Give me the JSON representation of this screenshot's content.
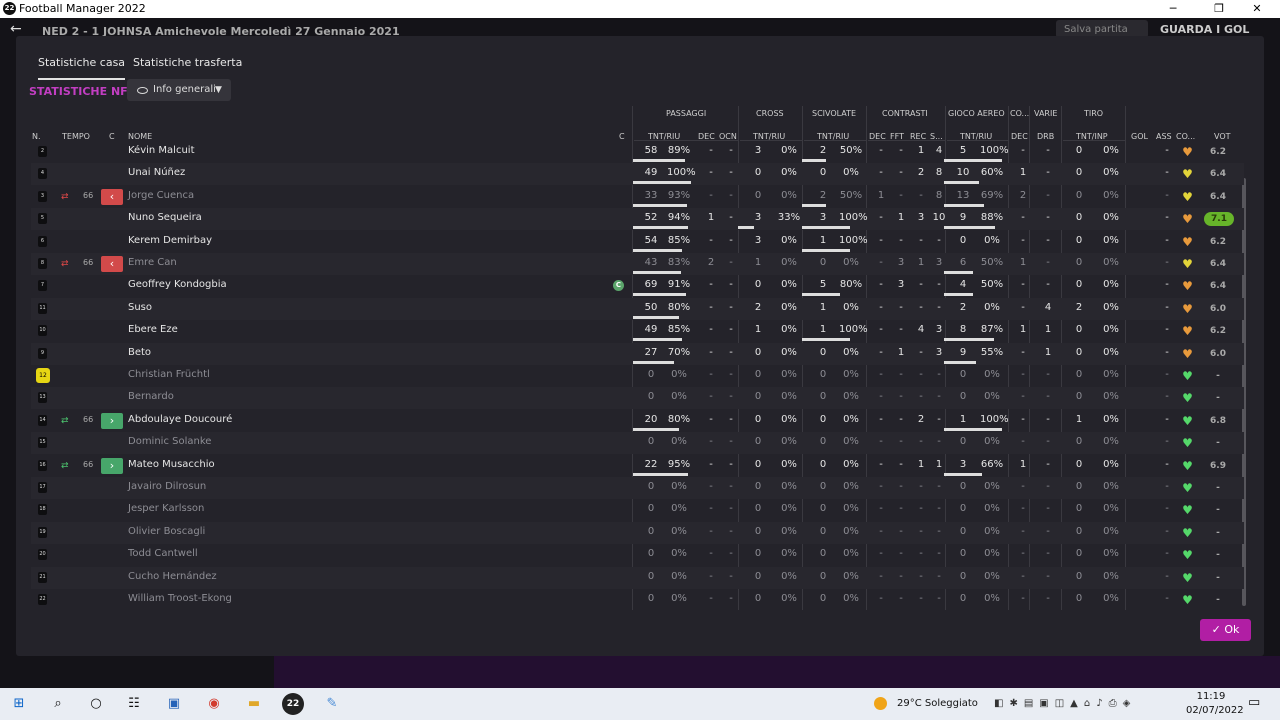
{
  "window": {
    "title": "Football Manager 2022",
    "logo": "22",
    "minimize": "─",
    "maximize": "❐",
    "close": "✕"
  },
  "topbar": {
    "match": "NED  2 - 1  JOHNSA  Amichevole  Mercoledì 27 Gennaio 2021",
    "save_label": "Salva partita",
    "watch_label": "GUARDA I GOL"
  },
  "tabs": [
    "Statistiche casa",
    "Statistiche trasferta"
  ],
  "team_label": "STATISTICHE NFD",
  "view_dropdown": "Info generali",
  "col_groups": {
    "passaggi": "PASSAGGI",
    "cross": "CROSS",
    "scivolate": "SCIVOLATE",
    "contrasti": "CONTRASTI",
    "gioco_aereo": "GIOCO AEREO",
    "co": "CO...",
    "varie": "VARIE",
    "tiro": "TIRO"
  },
  "cols": {
    "n": "N.",
    "tempo": "TEMPO",
    "c": "C",
    "nome": "NOME",
    "c2": "C",
    "tnt_riu": "TNT/RIU",
    "dec": "DEC",
    "ocn": "OCN",
    "fft": "FFT",
    "rec": "REC",
    "s": "S...",
    "drb": "DRB",
    "tnt_inp": "TNT/INP",
    "gol": "GOL",
    "ass": "ASS",
    "co": "CO...",
    "vot": "VOT"
  },
  "players": [
    {
      "num": "2",
      "name": "Kévin Malcuit",
      "active": true,
      "pass": [
        "58",
        "89%"
      ],
      "pdec": "-",
      "pocn": "-",
      "cross": [
        "3",
        "0%"
      ],
      "sciv": [
        "2",
        "50%"
      ],
      "cdec": "-",
      "cfft": "-",
      "crec": "1",
      "cs": "4",
      "aer": [
        "5",
        "100%"
      ],
      "adec": "-",
      "drb": "-",
      "tiro": [
        "0",
        "0%"
      ],
      "gol": "",
      "ass": "-",
      "heart": "orange",
      "rating": "6.2",
      "bars": [
        0.89,
        0,
        0.5,
        1
      ]
    },
    {
      "num": "4",
      "name": "Unai Núñez",
      "active": true,
      "pass": [
        "49",
        "100%"
      ],
      "pdec": "-",
      "pocn": "-",
      "cross": [
        "0",
        "0%"
      ],
      "sciv": [
        "0",
        "0%"
      ],
      "cdec": "-",
      "cfft": "-",
      "crec": "2",
      "cs": "8",
      "aer": [
        "10",
        "60%"
      ],
      "adec": "1",
      "drb": "-",
      "tiro": [
        "0",
        "0%"
      ],
      "gol": "",
      "ass": "-",
      "heart": "yellow",
      "rating": "6.4",
      "bars": [
        1,
        0,
        0,
        0.6
      ]
    },
    {
      "num": "3",
      "name": "Jorge Cuenca",
      "active": false,
      "sub": "out",
      "min": "66",
      "pass": [
        "33",
        "93%"
      ],
      "pdec": "-",
      "pocn": "-",
      "cross": [
        "0",
        "0%"
      ],
      "sciv": [
        "2",
        "50%"
      ],
      "cdec": "1",
      "cfft": "-",
      "crec": "-",
      "cs": "8",
      "aer": [
        "13",
        "69%"
      ],
      "adec": "2",
      "drb": "-",
      "tiro": [
        "0",
        "0%"
      ],
      "gol": "",
      "ass": "-",
      "heart": "yellow",
      "rating": "6.4",
      "bars": [
        0.93,
        0,
        0.5,
        0.69
      ]
    },
    {
      "num": "5",
      "name": "Nuno Sequeira",
      "active": true,
      "pass": [
        "52",
        "94%"
      ],
      "pdec": "1",
      "pocn": "-",
      "cross": [
        "3",
        "33%"
      ],
      "sciv": [
        "3",
        "100%"
      ],
      "cdec": "-",
      "cfft": "1",
      "crec": "3",
      "cs": "10",
      "aer": [
        "9",
        "88%"
      ],
      "adec": "-",
      "drb": "-",
      "tiro": [
        "0",
        "0%"
      ],
      "gol": "",
      "ass": "-",
      "heart": "orange",
      "rating": "7.1",
      "best": true,
      "bars": [
        0.94,
        0.33,
        1,
        0.88
      ]
    },
    {
      "num": "6",
      "name": "Kerem Demirbay",
      "active": true,
      "pass": [
        "54",
        "85%"
      ],
      "pdec": "-",
      "pocn": "-",
      "cross": [
        "3",
        "0%"
      ],
      "sciv": [
        "1",
        "100%"
      ],
      "cdec": "-",
      "cfft": "-",
      "crec": "-",
      "cs": "-",
      "aer": [
        "0",
        "0%"
      ],
      "adec": "-",
      "drb": "-",
      "tiro": [
        "0",
        "0%"
      ],
      "gol": "",
      "ass": "-",
      "heart": "orange",
      "rating": "6.2",
      "bars": [
        0.85,
        0,
        1,
        0
      ]
    },
    {
      "num": "8",
      "name": "Emre Can",
      "active": false,
      "sub": "out",
      "min": "66",
      "pass": [
        "43",
        "83%"
      ],
      "pdec": "2",
      "pocn": "-",
      "cross": [
        "1",
        "0%"
      ],
      "sciv": [
        "0",
        "0%"
      ],
      "cdec": "-",
      "cfft": "3",
      "crec": "1",
      "cs": "3",
      "aer": [
        "6",
        "50%"
      ],
      "adec": "1",
      "drb": "-",
      "tiro": [
        "0",
        "0%"
      ],
      "gol": "",
      "ass": "-",
      "heart": "yellow",
      "rating": "6.4",
      "bars": [
        0.83,
        0,
        0,
        0.5
      ]
    },
    {
      "num": "7",
      "name": "Geoffrey Kondogbia",
      "active": true,
      "captain": "C",
      "pass": [
        "69",
        "91%"
      ],
      "pdec": "-",
      "pocn": "-",
      "cross": [
        "0",
        "0%"
      ],
      "sciv": [
        "5",
        "80%"
      ],
      "cdec": "-",
      "cfft": "3",
      "crec": "-",
      "cs": "-",
      "aer": [
        "4",
        "50%"
      ],
      "adec": "-",
      "drb": "-",
      "tiro": [
        "0",
        "0%"
      ],
      "gol": "",
      "ass": "-",
      "heart": "orange",
      "rating": "6.4",
      "bars": [
        0.91,
        0,
        0.8,
        0.5
      ]
    },
    {
      "num": "11",
      "name": "Suso",
      "active": true,
      "pass": [
        "50",
        "80%"
      ],
      "pdec": "-",
      "pocn": "-",
      "cross": [
        "2",
        "0%"
      ],
      "sciv": [
        "1",
        "0%"
      ],
      "cdec": "-",
      "cfft": "-",
      "crec": "-",
      "cs": "-",
      "aer": [
        "2",
        "0%"
      ],
      "adec": "-",
      "drb": "4",
      "tiro": [
        "2",
        "0%"
      ],
      "gol": "",
      "ass": "-",
      "heart": "orange",
      "rating": "6.0",
      "bars": [
        0.8,
        0,
        0,
        0
      ]
    },
    {
      "num": "10",
      "name": "Ebere Eze",
      "active": true,
      "pass": [
        "49",
        "85%"
      ],
      "pdec": "-",
      "pocn": "-",
      "cross": [
        "1",
        "0%"
      ],
      "sciv": [
        "1",
        "100%"
      ],
      "cdec": "-",
      "cfft": "-",
      "crec": "4",
      "cs": "3",
      "aer": [
        "8",
        "87%"
      ],
      "adec": "1",
      "drb": "1",
      "tiro": [
        "0",
        "0%"
      ],
      "gol": "",
      "ass": "-",
      "heart": "orange",
      "rating": "6.2",
      "bars": [
        0.85,
        0,
        1,
        0.87
      ]
    },
    {
      "num": "9",
      "name": "Beto",
      "active": true,
      "pass": [
        "27",
        "70%"
      ],
      "pdec": "-",
      "pocn": "-",
      "cross": [
        "0",
        "0%"
      ],
      "sciv": [
        "0",
        "0%"
      ],
      "cdec": "-",
      "cfft": "1",
      "crec": "-",
      "cs": "3",
      "aer": [
        "9",
        "55%"
      ],
      "adec": "-",
      "drb": "1",
      "tiro": [
        "0",
        "0%"
      ],
      "gol": "",
      "ass": "-",
      "heart": "orange",
      "rating": "6.0",
      "bars": [
        0.7,
        0,
        0,
        0.55
      ]
    },
    {
      "num": "12",
      "name": "Christian Früchtl",
      "active": false,
      "gk": true,
      "pass": [
        "0",
        "0%"
      ],
      "pdec": "-",
      "pocn": "-",
      "cross": [
        "0",
        "0%"
      ],
      "sciv": [
        "0",
        "0%"
      ],
      "cdec": "-",
      "cfft": "-",
      "crec": "-",
      "cs": "-",
      "aer": [
        "0",
        "0%"
      ],
      "adec": "-",
      "drb": "-",
      "tiro": [
        "0",
        "0%"
      ],
      "gol": "",
      "ass": "-",
      "heart": "green",
      "rating": "-",
      "bars": [
        0,
        0,
        0,
        0
      ]
    },
    {
      "num": "13",
      "name": "Bernardo",
      "active": false,
      "pass": [
        "0",
        "0%"
      ],
      "pdec": "-",
      "pocn": "-",
      "cross": [
        "0",
        "0%"
      ],
      "sciv": [
        "0",
        "0%"
      ],
      "cdec": "-",
      "cfft": "-",
      "crec": "-",
      "cs": "-",
      "aer": [
        "0",
        "0%"
      ],
      "adec": "-",
      "drb": "-",
      "tiro": [
        "0",
        "0%"
      ],
      "gol": "",
      "ass": "-",
      "heart": "green",
      "rating": "-",
      "bars": [
        0,
        0,
        0,
        0
      ]
    },
    {
      "num": "14",
      "name": "Abdoulaye Doucouré",
      "active": true,
      "sub": "in",
      "min": "66",
      "pass": [
        "20",
        "80%"
      ],
      "pdec": "-",
      "pocn": "-",
      "cross": [
        "0",
        "0%"
      ],
      "sciv": [
        "0",
        "0%"
      ],
      "cdec": "-",
      "cfft": "-",
      "crec": "2",
      "cs": "-",
      "aer": [
        "1",
        "100%"
      ],
      "adec": "-",
      "drb": "-",
      "tiro": [
        "1",
        "0%"
      ],
      "gol": "",
      "ass": "-",
      "heart": "green",
      "rating": "6.8",
      "bars": [
        0.8,
        0,
        0,
        1
      ]
    },
    {
      "num": "15",
      "name": "Dominic Solanke",
      "active": false,
      "pass": [
        "0",
        "0%"
      ],
      "pdec": "-",
      "pocn": "-",
      "cross": [
        "0",
        "0%"
      ],
      "sciv": [
        "0",
        "0%"
      ],
      "cdec": "-",
      "cfft": "-",
      "crec": "-",
      "cs": "-",
      "aer": [
        "0",
        "0%"
      ],
      "adec": "-",
      "drb": "-",
      "tiro": [
        "0",
        "0%"
      ],
      "gol": "",
      "ass": "-",
      "heart": "green",
      "rating": "-",
      "bars": [
        0,
        0,
        0,
        0
      ]
    },
    {
      "num": "16",
      "name": "Mateo Musacchio",
      "active": true,
      "sub": "in",
      "min": "66",
      "pass": [
        "22",
        "95%"
      ],
      "pdec": "-",
      "pocn": "-",
      "cross": [
        "0",
        "0%"
      ],
      "sciv": [
        "0",
        "0%"
      ],
      "cdec": "-",
      "cfft": "-",
      "crec": "1",
      "cs": "1",
      "aer": [
        "3",
        "66%"
      ],
      "adec": "1",
      "drb": "-",
      "tiro": [
        "0",
        "0%"
      ],
      "gol": "",
      "ass": "-",
      "heart": "green",
      "rating": "6.9",
      "bars": [
        0.95,
        0,
        0,
        0.66
      ]
    },
    {
      "num": "17",
      "name": "Javairo Dilrosun",
      "active": false,
      "pass": [
        "0",
        "0%"
      ],
      "pdec": "-",
      "pocn": "-",
      "cross": [
        "0",
        "0%"
      ],
      "sciv": [
        "0",
        "0%"
      ],
      "cdec": "-",
      "cfft": "-",
      "crec": "-",
      "cs": "-",
      "aer": [
        "0",
        "0%"
      ],
      "adec": "-",
      "drb": "-",
      "tiro": [
        "0",
        "0%"
      ],
      "gol": "",
      "ass": "-",
      "heart": "green",
      "rating": "-",
      "bars": [
        0,
        0,
        0,
        0
      ]
    },
    {
      "num": "18",
      "name": "Jesper Karlsson",
      "active": false,
      "pass": [
        "0",
        "0%"
      ],
      "pdec": "-",
      "pocn": "-",
      "cross": [
        "0",
        "0%"
      ],
      "sciv": [
        "0",
        "0%"
      ],
      "cdec": "-",
      "cfft": "-",
      "crec": "-",
      "cs": "-",
      "aer": [
        "0",
        "0%"
      ],
      "adec": "-",
      "drb": "-",
      "tiro": [
        "0",
        "0%"
      ],
      "gol": "",
      "ass": "-",
      "heart": "green",
      "rating": "-",
      "bars": [
        0,
        0,
        0,
        0
      ]
    },
    {
      "num": "19",
      "name": "Olivier Boscagli",
      "active": false,
      "pass": [
        "0",
        "0%"
      ],
      "pdec": "-",
      "pocn": "-",
      "cross": [
        "0",
        "0%"
      ],
      "sciv": [
        "0",
        "0%"
      ],
      "cdec": "-",
      "cfft": "-",
      "crec": "-",
      "cs": "-",
      "aer": [
        "0",
        "0%"
      ],
      "adec": "-",
      "drb": "-",
      "tiro": [
        "0",
        "0%"
      ],
      "gol": "",
      "ass": "-",
      "heart": "green",
      "rating": "-",
      "bars": [
        0,
        0,
        0,
        0
      ]
    },
    {
      "num": "20",
      "name": "Todd Cantwell",
      "active": false,
      "pass": [
        "0",
        "0%"
      ],
      "pdec": "-",
      "pocn": "-",
      "cross": [
        "0",
        "0%"
      ],
      "sciv": [
        "0",
        "0%"
      ],
      "cdec": "-",
      "cfft": "-",
      "crec": "-",
      "cs": "-",
      "aer": [
        "0",
        "0%"
      ],
      "adec": "-",
      "drb": "-",
      "tiro": [
        "0",
        "0%"
      ],
      "gol": "",
      "ass": "-",
      "heart": "green",
      "rating": "-",
      "bars": [
        0,
        0,
        0,
        0
      ]
    },
    {
      "num": "21",
      "name": "Cucho Hernández",
      "active": false,
      "pass": [
        "0",
        "0%"
      ],
      "pdec": "-",
      "pocn": "-",
      "cross": [
        "0",
        "0%"
      ],
      "sciv": [
        "0",
        "0%"
      ],
      "cdec": "-",
      "cfft": "-",
      "crec": "-",
      "cs": "-",
      "aer": [
        "0",
        "0%"
      ],
      "adec": "-",
      "drb": "-",
      "tiro": [
        "0",
        "0%"
      ],
      "gol": "",
      "ass": "-",
      "heart": "green",
      "rating": "-",
      "bars": [
        0,
        0,
        0,
        0
      ]
    },
    {
      "num": "22",
      "name": "William Troost-Ekong",
      "active": false,
      "pass": [
        "0",
        "0%"
      ],
      "pdec": "-",
      "pocn": "-",
      "cross": [
        "0",
        "0%"
      ],
      "sciv": [
        "0",
        "0%"
      ],
      "cdec": "-",
      "cfft": "-",
      "crec": "-",
      "cs": "-",
      "aer": [
        "0",
        "0%"
      ],
      "adec": "-",
      "drb": "-",
      "tiro": [
        "0",
        "0%"
      ],
      "gol": "",
      "ass": "-",
      "heart": "green",
      "rating": "-",
      "bars": [
        0,
        0,
        0,
        0
      ]
    }
  ],
  "heart_colors": {
    "orange": "#e89a3c",
    "yellow": "#e2d43a",
    "green": "#55d86a"
  },
  "ok_label": "✓ Ok",
  "taskbar": {
    "weather": "29°C  Soleggiato",
    "time": "11:19",
    "date": "02/07/2022",
    "icons": [
      "windows-icon",
      "search-icon",
      "cortana-icon",
      "task-view-icon",
      "remote-desktop-icon",
      "chrome-icon",
      "file-explorer-icon",
      "football-manager-icon",
      "paint-icon"
    ]
  }
}
